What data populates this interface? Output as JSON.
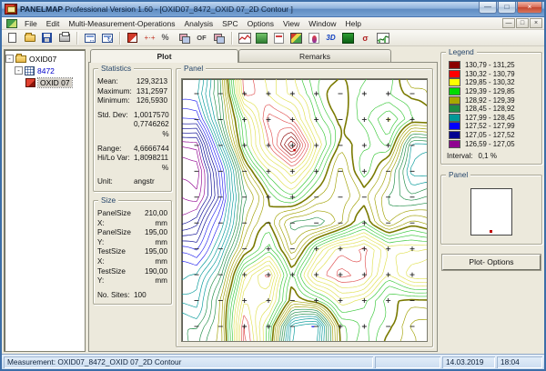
{
  "window": {
    "app_name": "PANELMAP",
    "title_suffix": " Professional Version 1.60 - [OXID07_8472_OXID 07_2D Contour ]",
    "caption_buttons": {
      "minimize": "—",
      "maximize": "□",
      "close": "×"
    },
    "mdi_buttons": {
      "minimize": "—",
      "restore": "□",
      "close": "×"
    }
  },
  "menu": {
    "items": [
      "File",
      "Edit",
      "Multi-Measurement-Operations",
      "Analysis",
      "SPC",
      "Options",
      "View",
      "Window",
      "Help"
    ]
  },
  "toolbar": {
    "icons": [
      "new-file-icon",
      "open-file-icon",
      "save-icon",
      "print-icon",
      "copy-measurement-icon",
      "compare-measurement-icon",
      "delete-sites-icon",
      "edit-points-icon",
      "cut-percent-icon",
      "copy-icon",
      "offset-icon",
      "paste-icon",
      "line-chart-icon",
      "contour-plot-icon",
      "data-table-icon",
      "color-map-icon",
      "distribution-icon",
      "3d-plot-icon",
      "surface-plot-icon",
      "sigma-chart-icon",
      "trend-chart-icon"
    ],
    "of_label": "OF",
    "threed_label": "3D",
    "sigma_label": "σ"
  },
  "tree": {
    "items": [
      {
        "label": "OXID07",
        "icon": "folder"
      },
      {
        "label": "8472",
        "icon": "grid"
      },
      {
        "label": "OXID 07",
        "icon": "measurement",
        "selected": true
      }
    ],
    "expander": "-"
  },
  "tabs": {
    "plot": "Plot",
    "remarks": "Remarks"
  },
  "statistics": {
    "title": "Statistics",
    "rows": [
      {
        "label": "Mean:",
        "value": "129,3213"
      },
      {
        "label": "Maximum:",
        "value": "131,2597"
      },
      {
        "label": "Minimum:",
        "value": "126,5930"
      },
      {
        "label": "Std. Dev:",
        "value": "1,0017570"
      },
      {
        "label": "",
        "value": "0,7746262 %"
      },
      {
        "label": "Range:",
        "value": "4,6666744"
      },
      {
        "label": "Hi/Lo Var:",
        "value": "1,8098211 %"
      },
      {
        "label": "Unit:",
        "value": "angstr"
      }
    ]
  },
  "size": {
    "title": "Size",
    "rows": [
      {
        "label": "PanelSize X:",
        "value": "210,00 mm"
      },
      {
        "label": "PanelSize Y:",
        "value": "195,00 mm"
      },
      {
        "label": "TestSize X:",
        "value": "195,00 mm"
      },
      {
        "label": "TestSize Y:",
        "value": "190,00 mm"
      },
      {
        "label": "No. Sites:",
        "value": "100"
      }
    ]
  },
  "panel_plot": {
    "title": "Panel"
  },
  "legend": {
    "title": "Legend",
    "entries": [
      {
        "color": "#8B0000",
        "range": "130,79 - 131,25"
      },
      {
        "color": "#FF0000",
        "range": "130,32 - 130,79"
      },
      {
        "color": "#FFFF00",
        "range": "129,85 - 130,32"
      },
      {
        "color": "#00DC00",
        "range": "129,39 - 129,85"
      },
      {
        "color": "#A8A800",
        "range": "128,92 - 129,39"
      },
      {
        "color": "#1E8C46",
        "range": "128,45 - 128,92"
      },
      {
        "color": "#009898",
        "range": "127,99 - 128,45"
      },
      {
        "color": "#0000FF",
        "range": "127,52 - 127,99"
      },
      {
        "color": "#000090",
        "range": "127,05 - 127,52"
      },
      {
        "color": "#900090",
        "range": "126,59 - 127,05"
      }
    ],
    "interval_label": "Interval:",
    "interval_value": "0,1 %"
  },
  "panel_preview": {
    "title": "Panel"
  },
  "plot_options_button": "Plot- Options",
  "statusbar": {
    "measurement": "Measurement: OXID07_8472_OXID 07_2D Contour",
    "field2": "",
    "date": "14.03.2019",
    "time": "18:04"
  },
  "chart_data": {
    "type": "heatmap",
    "subtype": "2d-contour-map",
    "title": "Panel",
    "unit": "angstr",
    "sites": 100,
    "mean": 129.3213,
    "min": 126.593,
    "max": 131.2597,
    "contour_interval_percent": 0.1,
    "levels": {
      "start": 126.72,
      "step": 0.13,
      "end": 131.2
    },
    "grid": {
      "cols": 10,
      "rows": 10,
      "values": [
        [
          128.0,
          128.8,
          130.4,
          130.2,
          129.9,
          129.5,
          129.3,
          129.4,
          129.5,
          129.2
        ],
        [
          127.6,
          128.6,
          129.8,
          130.6,
          130.3,
          129.7,
          129.2,
          129.6,
          129.9,
          129.4
        ],
        [
          126.9,
          128.2,
          129.6,
          130.3,
          131.26,
          130.0,
          129.2,
          129.4,
          129.6,
          128.4
        ],
        [
          126.59,
          127.8,
          129.0,
          129.8,
          130.2,
          129.6,
          129.1,
          129.5,
          129.0,
          128.2
        ],
        [
          126.8,
          127.5,
          128.8,
          129.4,
          129.6,
          129.2,
          128.9,
          129.3,
          128.8,
          128.6
        ],
        [
          127.2,
          127.9,
          128.9,
          129.3,
          128.8,
          128.7,
          129.0,
          129.4,
          129.0,
          129.2
        ],
        [
          127.6,
          128.3,
          129.2,
          129.6,
          128.9,
          129.8,
          130.3,
          130.5,
          129.8,
          130.0
        ],
        [
          128.0,
          128.6,
          129.9,
          130.5,
          129.4,
          130.2,
          130.6,
          130.4,
          129.9,
          130.2
        ],
        [
          128.3,
          128.9,
          130.2,
          130.1,
          129.2,
          129.5,
          129.9,
          129.7,
          129.4,
          129.3
        ],
        [
          128.5,
          129.0,
          130.6,
          129.6,
          128.0,
          127.9,
          129.4,
          129.7,
          129.3,
          129.0
        ]
      ]
    },
    "bands": [
      {
        "min": 126.59,
        "max": 127.05,
        "color": "#900090"
      },
      {
        "min": 127.05,
        "max": 127.52,
        "color": "#000090"
      },
      {
        "min": 127.52,
        "max": 127.99,
        "color": "#2222EE"
      },
      {
        "min": 127.99,
        "max": 128.45,
        "color": "#009898"
      },
      {
        "min": 128.45,
        "max": 128.92,
        "color": "#1E8C46"
      },
      {
        "min": 128.92,
        "max": 129.39,
        "color": "#A0A000"
      },
      {
        "min": 129.39,
        "max": 129.85,
        "color": "#38C838"
      },
      {
        "min": 129.85,
        "max": 130.32,
        "color": "#E0E050"
      },
      {
        "min": 130.32,
        "max": 130.79,
        "color": "#E05050"
      },
      {
        "min": 130.79,
        "max": 131.25,
        "color": "#8B0000"
      }
    ],
    "site_mark_rule": "plus if value >= mean else minus"
  }
}
